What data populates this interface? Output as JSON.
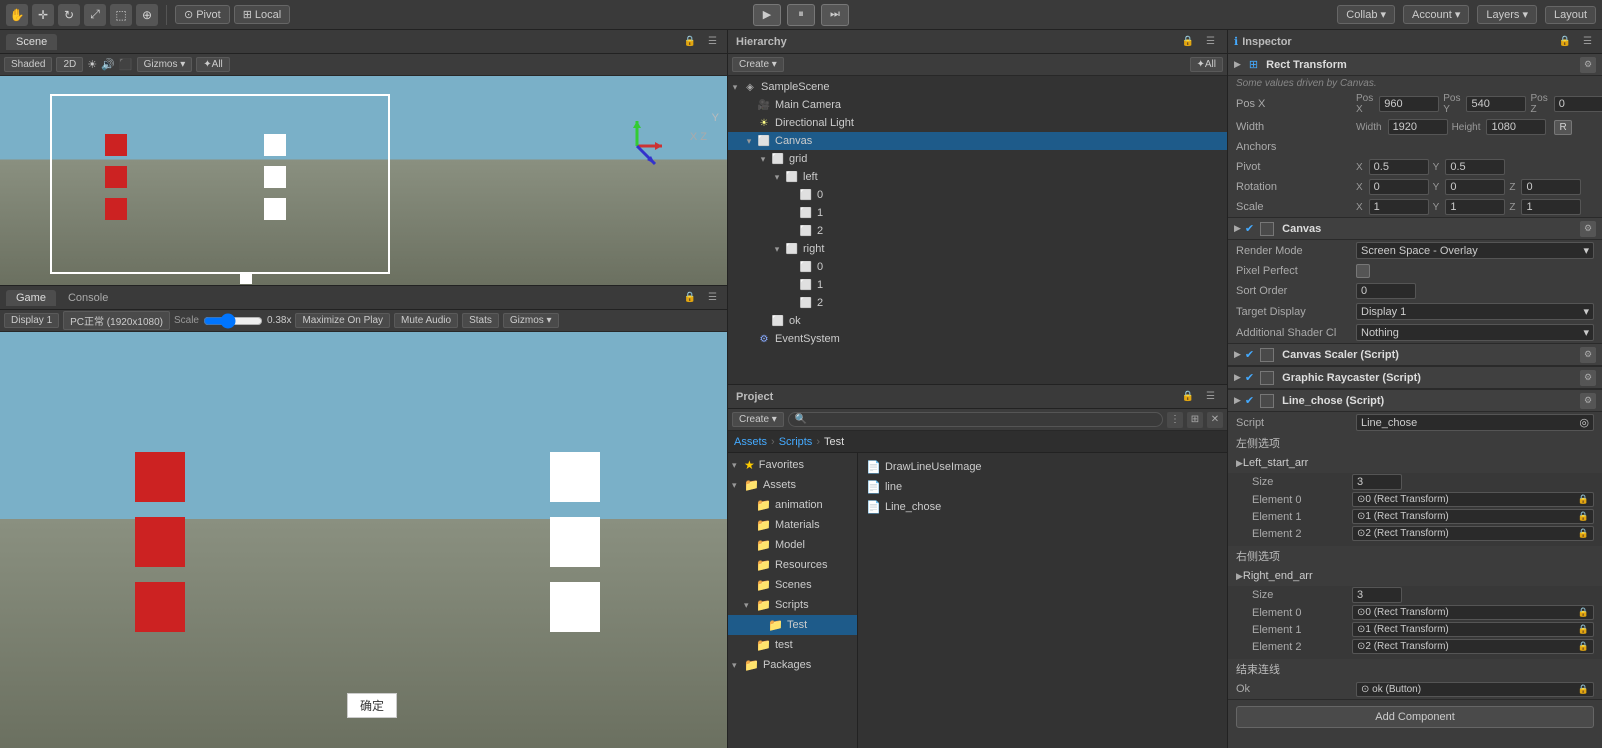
{
  "toolbar": {
    "icons": [
      "hand",
      "move",
      "rotate",
      "scale",
      "rect",
      "transform"
    ],
    "pivot_label": "Pivot",
    "local_label": "Local",
    "play_icon": "▶",
    "pause_icon": "⏸",
    "step_icon": "⏭",
    "collab_label": "Collab ▾",
    "account_label": "Account ▾",
    "layers_label": "Layers ▾",
    "layout_label": "Layout"
  },
  "scene": {
    "tab_label": "Scene",
    "shaded_label": "Shaded",
    "gizmos_label": "Gizmos ▾",
    "all_label": "✦All"
  },
  "game": {
    "tab_label": "Game",
    "console_tab": "Console",
    "display_label": "Display 1",
    "resolution_label": "PC正常 (1920x1080)",
    "scale_label": "Scale",
    "scale_value": "0.38x",
    "maximize_label": "Maximize On Play",
    "mute_label": "Mute Audio",
    "stats_label": "Stats",
    "gizmos_label": "Gizmos ▾",
    "ok_button_text": "确定"
  },
  "hierarchy": {
    "panel_title": "Hierarchy",
    "create_label": "Create ▾",
    "all_label": "✦All",
    "items": [
      {
        "label": "SampleScene",
        "level": 0,
        "arrow": "▾",
        "icon": "◈",
        "type": "scene"
      },
      {
        "label": "Main Camera",
        "level": 1,
        "arrow": "",
        "icon": "🎥",
        "type": "camera"
      },
      {
        "label": "Directional Light",
        "level": 1,
        "arrow": "",
        "icon": "☀",
        "type": "light"
      },
      {
        "label": "Canvas",
        "level": 1,
        "arrow": "▾",
        "icon": "⬜",
        "type": "go"
      },
      {
        "label": "grid",
        "level": 2,
        "arrow": "▾",
        "icon": "⬜",
        "type": "go"
      },
      {
        "label": "left",
        "level": 3,
        "arrow": "▾",
        "icon": "⬜",
        "type": "go"
      },
      {
        "label": "0",
        "level": 4,
        "arrow": "",
        "icon": "⬜",
        "type": "go"
      },
      {
        "label": "1",
        "level": 4,
        "arrow": "",
        "icon": "⬜",
        "type": "go"
      },
      {
        "label": "2",
        "level": 4,
        "arrow": "",
        "icon": "⬜",
        "type": "go"
      },
      {
        "label": "right",
        "level": 3,
        "arrow": "▾",
        "icon": "⬜",
        "type": "go"
      },
      {
        "label": "0",
        "level": 4,
        "arrow": "",
        "icon": "⬜",
        "type": "go"
      },
      {
        "label": "1",
        "level": 4,
        "arrow": "",
        "icon": "⬜",
        "type": "go"
      },
      {
        "label": "2",
        "level": 4,
        "arrow": "",
        "icon": "⬜",
        "type": "go"
      },
      {
        "label": "ok",
        "level": 2,
        "arrow": "",
        "icon": "⬜",
        "type": "go"
      },
      {
        "label": "EventSystem",
        "level": 1,
        "arrow": "",
        "icon": "⚙",
        "type": "go"
      }
    ]
  },
  "project": {
    "panel_title": "Project",
    "create_label": "Create ▾",
    "breadcrumb": [
      "Assets",
      "Scripts",
      "Test"
    ],
    "folders": [
      {
        "label": "Favorites",
        "level": 0,
        "arrow": "▾",
        "icon": "★",
        "star": true
      },
      {
        "label": "Assets",
        "level": 0,
        "arrow": "▾",
        "icon": "📁"
      },
      {
        "label": "animation",
        "level": 1,
        "arrow": "",
        "icon": "📁"
      },
      {
        "label": "Materials",
        "level": 1,
        "arrow": "",
        "icon": "📁"
      },
      {
        "label": "Model",
        "level": 1,
        "arrow": "",
        "icon": "📁"
      },
      {
        "label": "Resources",
        "level": 1,
        "arrow": "",
        "icon": "📁"
      },
      {
        "label": "Scenes",
        "level": 1,
        "arrow": "",
        "icon": "📁"
      },
      {
        "label": "Scripts",
        "level": 1,
        "arrow": "▾",
        "icon": "📁"
      },
      {
        "label": "Test",
        "level": 2,
        "arrow": "",
        "icon": "📁",
        "selected": true
      },
      {
        "label": "test",
        "level": 1,
        "arrow": "",
        "icon": "📁"
      },
      {
        "label": "Packages",
        "level": 0,
        "arrow": "▾",
        "icon": "📁"
      }
    ],
    "files": [
      {
        "label": "DrawLineUseImage",
        "icon": "📄"
      },
      {
        "label": "line",
        "icon": "📄"
      },
      {
        "label": "Line_chose",
        "icon": "📄"
      }
    ]
  },
  "inspector": {
    "panel_title": "Inspector",
    "sections": {
      "rect_transform": {
        "title": "Rect Transform",
        "note": "Some values driven by Canvas.",
        "pos_x": "960",
        "pos_y": "540",
        "pos_z": "0",
        "width": "1920",
        "height": "1080",
        "anchors_label": "Anchors",
        "pivot_label": "Pivot",
        "pivot_x": "0.5",
        "pivot_y": "0.5",
        "rotation_label": "Rotation",
        "rot_x": "0",
        "rot_y": "0",
        "rot_z": "0",
        "scale_label": "Scale",
        "scale_x": "1",
        "scale_y": "1",
        "scale_z": "1"
      },
      "canvas": {
        "title": "Canvas",
        "render_mode_label": "Render Mode",
        "render_mode_value": "Screen Space - Overlay",
        "pixel_perfect_label": "Pixel Perfect",
        "sort_order_label": "Sort Order",
        "sort_order_value": "0",
        "target_display_label": "Target Display",
        "target_display_value": "Display 1",
        "additional_shader_label": "Additional Shader Cl",
        "additional_shader_value": "Nothing"
      },
      "canvas_scaler": {
        "title": "Canvas Scaler (Script)"
      },
      "graphic_raycaster": {
        "title": "Graphic Raycaster (Script)"
      },
      "line_chose": {
        "title": "Line_chose (Script)",
        "script_label": "Script",
        "script_value": "Line_chose",
        "left_section_label": "左侧选项",
        "left_arr_label": "Left_start_arr",
        "left_size_label": "Size",
        "left_size_value": "3",
        "left_el0": "⊙0 (Rect Transform)",
        "left_el1": "⊙1 (Rect Transform)",
        "left_el2": "⊙2 (Rect Transform)",
        "right_section_label": "右侧选项",
        "right_arr_label": "Right_end_arr",
        "right_size_label": "Size",
        "right_size_value": "3",
        "right_el0": "⊙0 (Rect Transform)",
        "right_el1": "⊙1 (Rect Transform)",
        "right_el2": "⊙2 (Rect Transform)",
        "end_label": "结束连线",
        "ok_label": "Ok",
        "ok_value": "⊙ ok (Button)"
      }
    },
    "add_component_label": "Add Component"
  }
}
